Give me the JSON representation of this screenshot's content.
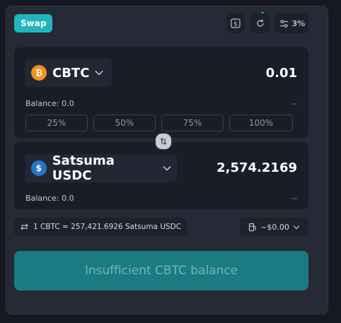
{
  "header": {
    "tab_label": "Swap",
    "slippage": "3%"
  },
  "from": {
    "token": "CBTC",
    "amount": "0.01",
    "balance": "Balance: 0.0",
    "usd_value": "--",
    "percent_buttons": [
      "25%",
      "50%",
      "75%",
      "100%"
    ]
  },
  "to": {
    "token": "Satsuma USDC",
    "amount": "2,574.2169",
    "balance": "Balance: 0.0",
    "usd_value": "--"
  },
  "rate": "1 CBTC = 257,421.6926 Satsuma USDC",
  "gas_fee": "~$0.00",
  "submit_label": "Insufficient CBTC balance",
  "icons": {
    "btc": "₿",
    "usdc": "$"
  },
  "colors": {
    "accent": "#20b6bd",
    "submit_bg": "#1b7b82",
    "btc": "#f5921b",
    "usdc": "#2775ca"
  }
}
